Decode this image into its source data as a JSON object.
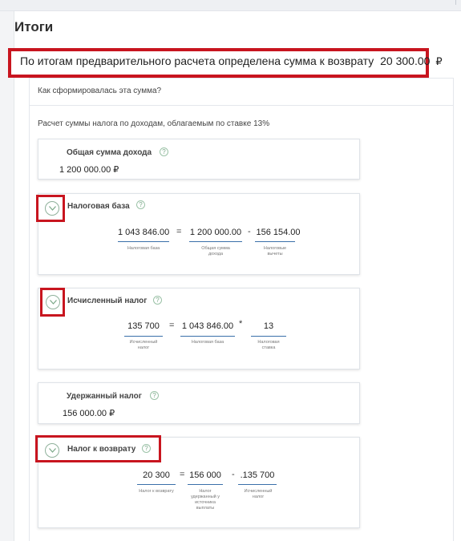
{
  "title": "Итоги",
  "summary": {
    "text": "По итогам предварительного расчета определена сумма к возврату",
    "amount": "20 300.00",
    "currency": "₽"
  },
  "question": "Как сформировалась эта сумма?",
  "subtitle": "Расчет суммы налога по доходам, облагаемым по ставке 13%",
  "cards": {
    "income": {
      "title": "Общая сумма дохода",
      "value": "1 200 000.00",
      "currency": "₽"
    },
    "tax_base": {
      "title": "Налоговая база",
      "v1": "1 043 846.00",
      "op1": "=",
      "v2": "1 200 000.00",
      "op2": "-",
      "v3": "156 154.00",
      "c1": "Налоговая база",
      "c2": "Общая сумма дохода",
      "c3": "Налоговые вычеты"
    },
    "computed_tax": {
      "title": "Исчисленный налог",
      "v1": "135 700",
      "op1": "=",
      "v2": "1 043 846.00",
      "op2": "*",
      "v3": "13",
      "c1": "Исчисленный налог",
      "c2": "Налоговая база",
      "c3": "Налоговая ставка"
    },
    "withheld": {
      "title": "Удержанный налог",
      "value": "156 000.00",
      "currency": "₽"
    },
    "refund": {
      "title": "Налог к возврату",
      "v1": "20 300",
      "op1": "=",
      "v2": "156 000",
      "op2": "-",
      "v3": ".135 700",
      "c1": "Налог к возврату",
      "c2": "Налог удержанный у источника выплаты",
      "c3": "Исчисленный налог"
    }
  },
  "help_glyph": "?",
  "icons": {
    "expand": "chevron-down-circle-icon",
    "help": "question-circle-icon"
  },
  "colors": {
    "highlight": "#c8151f",
    "accent_line": "#3a6fa9",
    "icon_green": "#8fb19b"
  }
}
